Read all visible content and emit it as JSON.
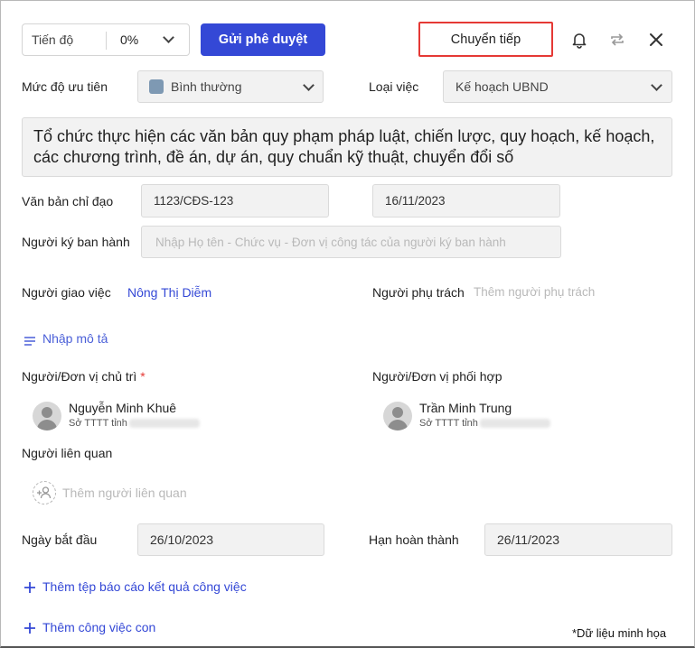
{
  "toolbar": {
    "progress_label": "Tiến độ",
    "progress_value": "0%",
    "submit_button": "Gửi phê duyệt",
    "forward_button": "Chuyển tiếp",
    "highlight_color": "#e53935",
    "primary_color": "#3448d6"
  },
  "fields": {
    "priority_label": "Mức độ ưu tiên",
    "priority_value": "Bình thường",
    "priority_color": "#7e99b3",
    "type_label": "Loại việc",
    "type_value": "Kế hoạch UBND",
    "title_text": "Tổ chức thực hiện các văn bản quy phạm pháp luật, chiến lược, quy hoạch, kế hoạch, các chương trình, đề án, dự án, quy chuẩn kỹ thuật, chuyển đổi số",
    "directive_label": "Văn bản chỉ đạo",
    "directive_number": "1123/CĐS-123",
    "directive_date": "16/11/2023",
    "signer_label": "Người ký ban hành",
    "signer_placeholder": "Nhập Họ tên - Chức vụ - Đơn vị công tác của người ký ban hành",
    "assigner_label": "Người giao việc",
    "assigner_value": "Nông Thị Diễm",
    "owner_label": "Người phụ trách",
    "owner_placeholder": "Thêm người phụ trách",
    "description_link": "Nhập mô tả",
    "lead_label": "Người/Đơn vị chủ trì",
    "required_mark": "*",
    "lead_name": "Nguyễn Minh Khuê",
    "lead_org": "Sở TTTT tỉnh",
    "coop_label": "Người/Đơn vị phối hợp",
    "coop_name": "Trần Minh Trung",
    "coop_org": "Sở TTTT tỉnh",
    "related_label": "Người liên quan",
    "related_placeholder": "Thêm người liên quan",
    "start_label": "Ngày bắt đầu",
    "start_value": "26/10/2023",
    "deadline_label": "Hạn hoàn thành",
    "deadline_value": "26/11/2023",
    "add_report_link": "Thêm tệp báo cáo kết quả công việc",
    "add_subtask_link": "Thêm công việc con"
  },
  "footnote": "*Dữ liệu minh họa",
  "icons": [
    "chevron-down-icon",
    "bell-icon",
    "repeat-icon",
    "close-icon",
    "menu-lines-icon",
    "plus-icon",
    "add-person-icon",
    "avatar-icon"
  ]
}
